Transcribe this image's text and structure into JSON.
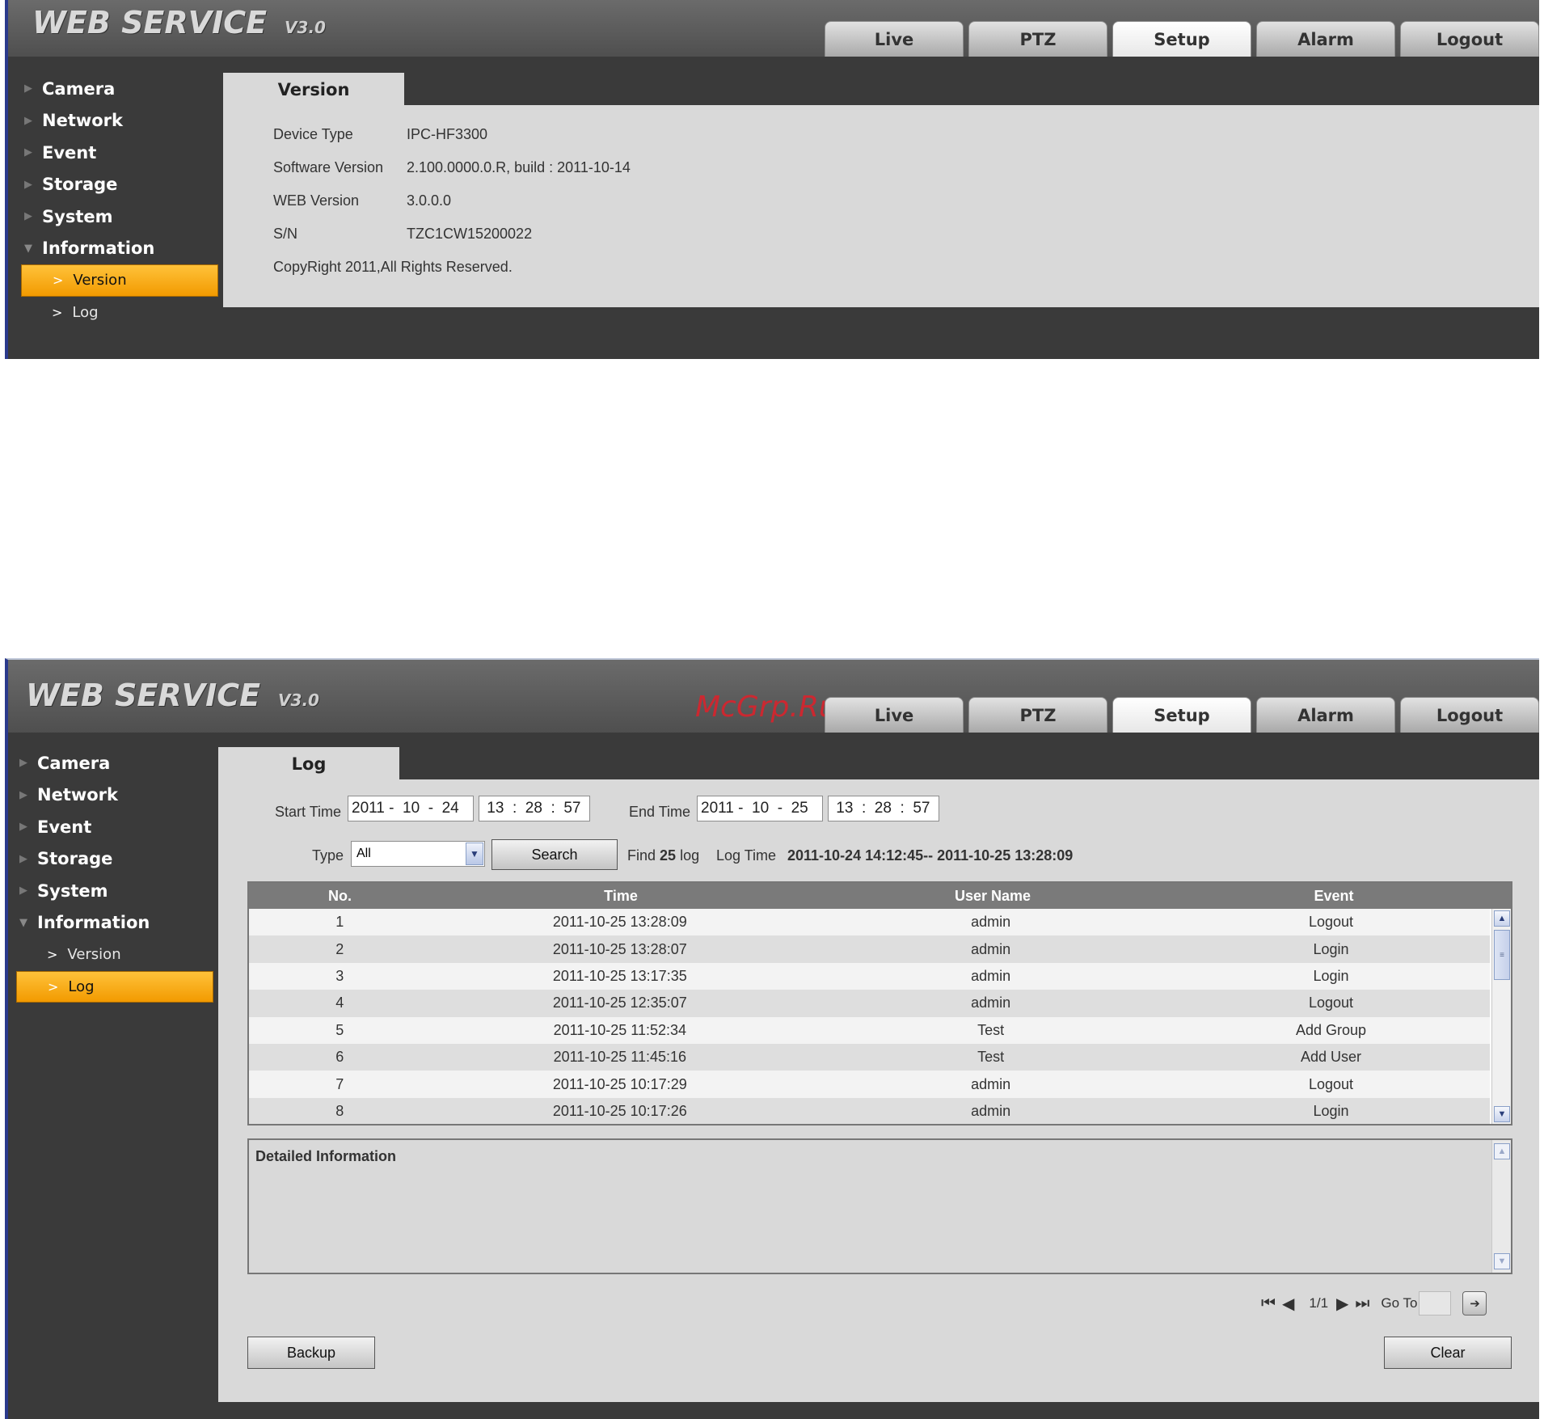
{
  "app": {
    "logo_main": "WEB  SERVICE",
    "logo_version": "V3.0"
  },
  "nav": {
    "tabs": [
      "Live",
      "PTZ",
      "Setup",
      "Alarm",
      "Logout"
    ],
    "active": "Setup"
  },
  "sidebar": {
    "items": [
      "Camera",
      "Network",
      "Event",
      "Storage",
      "System",
      "Information"
    ],
    "sub_items": [
      "Version",
      "Log"
    ]
  },
  "version_page": {
    "tab_label": "Version",
    "rows": [
      {
        "label": "Device Type",
        "value": "IPC-HF3300"
      },
      {
        "label": "Software Version",
        "value": "2.100.0000.0.R, build : 2011-10-14"
      },
      {
        "label": "WEB Version",
        "value": "3.0.0.0"
      },
      {
        "label": "S/N",
        "value": "TZC1CW15200022"
      }
    ],
    "copyright": "CopyRight 2011,All Rights Reserved."
  },
  "log_page": {
    "tab_label": "Log",
    "start_time_label": "Start Time",
    "start_date": "2011 -  10  -  24",
    "start_time": " 13  :  28  :  57",
    "end_time_label": "End Time",
    "end_date": "2011 -  10  -  25",
    "end_time": " 13  :  28  :  57",
    "type_label": "Type",
    "type_value": "All",
    "search_label": "Search",
    "find_prefix": "Find",
    "find_count": "25",
    "find_suffix": "log",
    "log_time_label": "Log Time",
    "log_time_value": "2011-10-24 14:12:45-- 2011-10-25 13:28:09",
    "columns": [
      "No.",
      "Time",
      "User Name",
      "Event"
    ],
    "rows": [
      [
        "1",
        "2011-10-25 13:28:09",
        "admin",
        "Logout"
      ],
      [
        "2",
        "2011-10-25 13:28:07",
        "admin",
        "Login"
      ],
      [
        "3",
        "2011-10-25 13:17:35",
        "admin",
        "Login"
      ],
      [
        "4",
        "2011-10-25 12:35:07",
        "admin",
        "Logout"
      ],
      [
        "5",
        "2011-10-25 11:52:34",
        "Test",
        "Add Group"
      ],
      [
        "6",
        "2011-10-25 11:45:16",
        "Test",
        "Add User"
      ],
      [
        "7",
        "2011-10-25 10:17:29",
        "admin",
        "Logout"
      ],
      [
        "8",
        "2011-10-25 10:17:26",
        "admin",
        "Login"
      ]
    ],
    "detail_title": "Detailed Information",
    "page_indicator": "1/1",
    "goto_label": "Go To",
    "backup_label": "Backup",
    "clear_label": "Clear"
  },
  "watermark": "McGrp.Ru",
  "colors": {
    "accent": "#f7a600",
    "panel_bg": "#3a3a3a",
    "content_bg": "#d9d9d9"
  }
}
